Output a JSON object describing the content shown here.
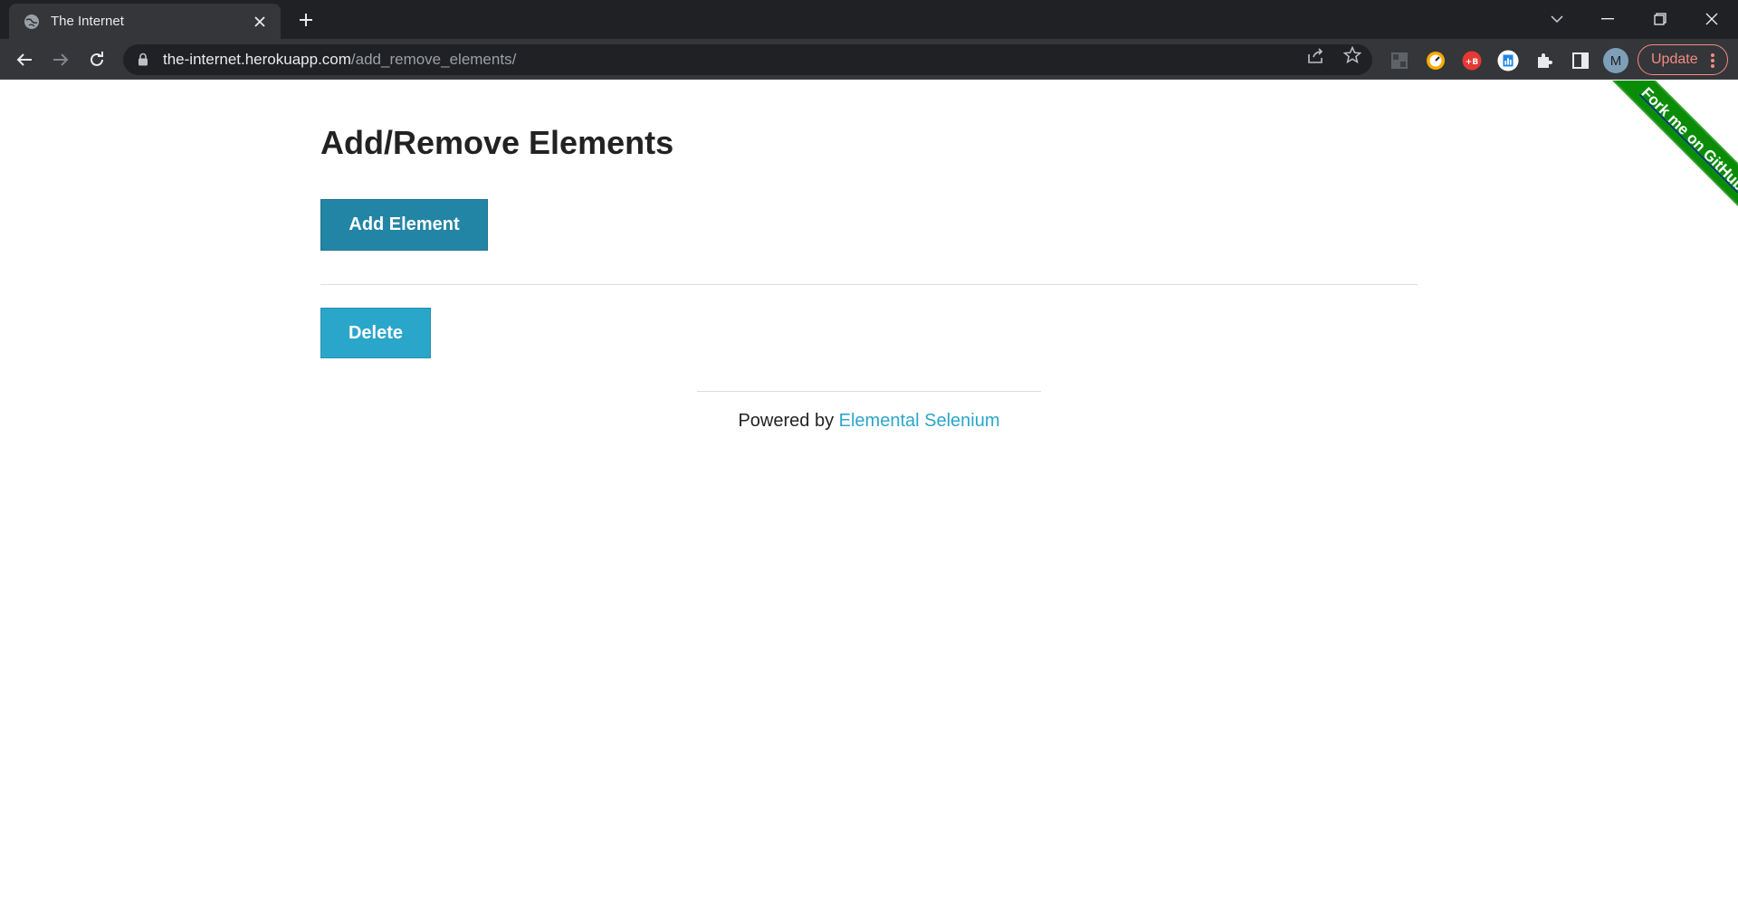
{
  "browser": {
    "tab_title": "The Internet",
    "url_host": "the-internet.herokuapp.com",
    "url_path": "/add_remove_elements/",
    "profile_initial": "M",
    "update_label": "Update"
  },
  "page": {
    "heading": "Add/Remove Elements",
    "add_button_label": "Add Element",
    "delete_button_label": "Delete",
    "footer_prefix": "Powered by ",
    "footer_link": "Elemental Selenium",
    "ribbon_text": "Fork me on GitHub"
  },
  "colors": {
    "add_button": "#2385a5",
    "delete_button": "#2ba6cb",
    "link": "#2ba6cb",
    "ribbon": "#0b8c07",
    "update_accent": "#f28b82"
  }
}
